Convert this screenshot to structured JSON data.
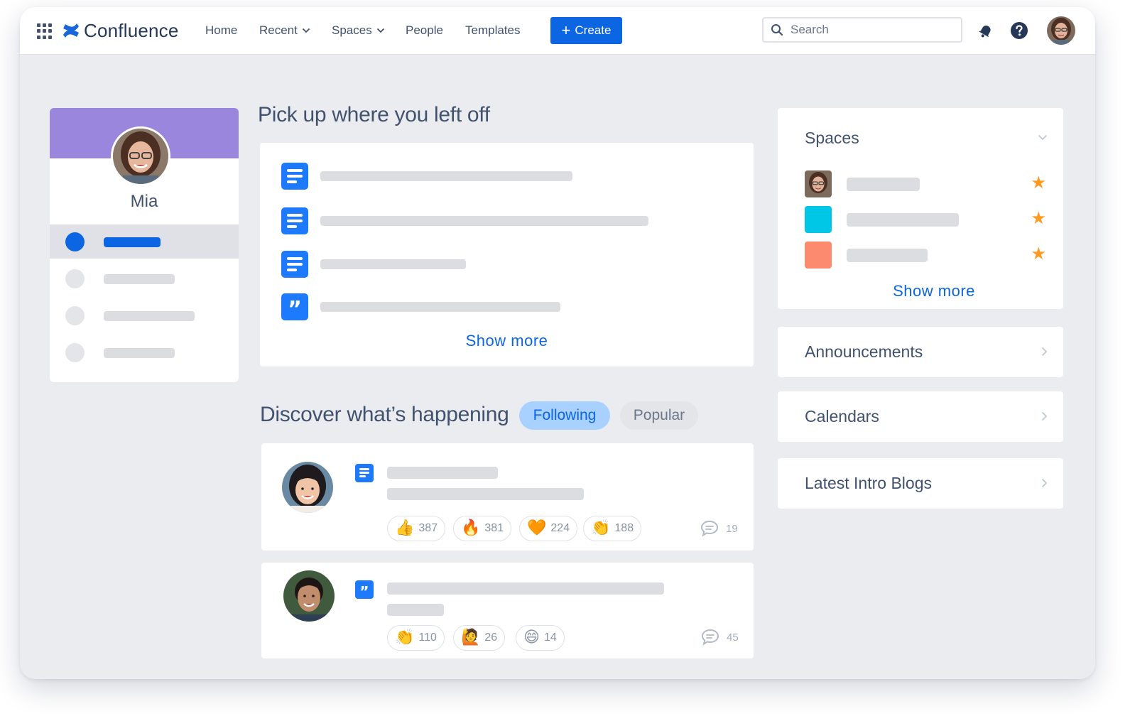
{
  "app": {
    "name": "Confluence"
  },
  "nav": {
    "home": "Home",
    "recent": "Recent",
    "spaces": "Spaces",
    "people": "People",
    "templates": "Templates",
    "create": "Create"
  },
  "search": {
    "placeholder": "Search"
  },
  "profile": {
    "name": "Mia"
  },
  "recent_section": {
    "title": "Pick up where you left off",
    "items": [
      {
        "icon": "page-icon"
      },
      {
        "icon": "page-icon"
      },
      {
        "icon": "page-icon"
      },
      {
        "icon": "quote-icon"
      }
    ],
    "show_more": "Show more"
  },
  "discover": {
    "title": "Discover what’s happening",
    "tabs": [
      "Following",
      "Popular"
    ],
    "active_tab": "Following",
    "posts": [
      {
        "type_icon": "page-icon",
        "reactions": [
          {
            "emoji": "👍",
            "icon": "thumbs-up-icon",
            "count": "387"
          },
          {
            "emoji": "🔥",
            "icon": "fire-icon",
            "count": "381"
          },
          {
            "emoji": "🧡",
            "icon": "orange-heart-icon",
            "count": "224"
          },
          {
            "emoji": "👏",
            "icon": "clapping-hands-icon",
            "count": "188"
          }
        ],
        "comments": "19"
      },
      {
        "type_icon": "quote-icon",
        "reactions": [
          {
            "emoji": "👏",
            "icon": "clapping-hands-icon",
            "count": "110"
          },
          {
            "emoji": "🙋",
            "icon": "raising-hand-icon",
            "count": "26"
          },
          {
            "emoji": "😄",
            "icon": "grinning-face-icon",
            "count": "14"
          }
        ],
        "comments": "45"
      }
    ]
  },
  "sidebar": {
    "spaces": {
      "title": "Spaces",
      "items": [
        {
          "thumb": "avatar",
          "starred": true
        },
        {
          "thumb_color": "#00c7e6",
          "starred": true
        },
        {
          "thumb_color": "#fc8a6e",
          "starred": true
        }
      ],
      "show_more": "Show more"
    },
    "announcements": "Announcements",
    "calendars": "Calendars",
    "latest_blogs": "Latest Intro Blogs"
  },
  "colors": {
    "accent": "#0c66e4",
    "banner": "#9a86dd",
    "star": "#ff991f",
    "page_background": "#ebecf0"
  }
}
